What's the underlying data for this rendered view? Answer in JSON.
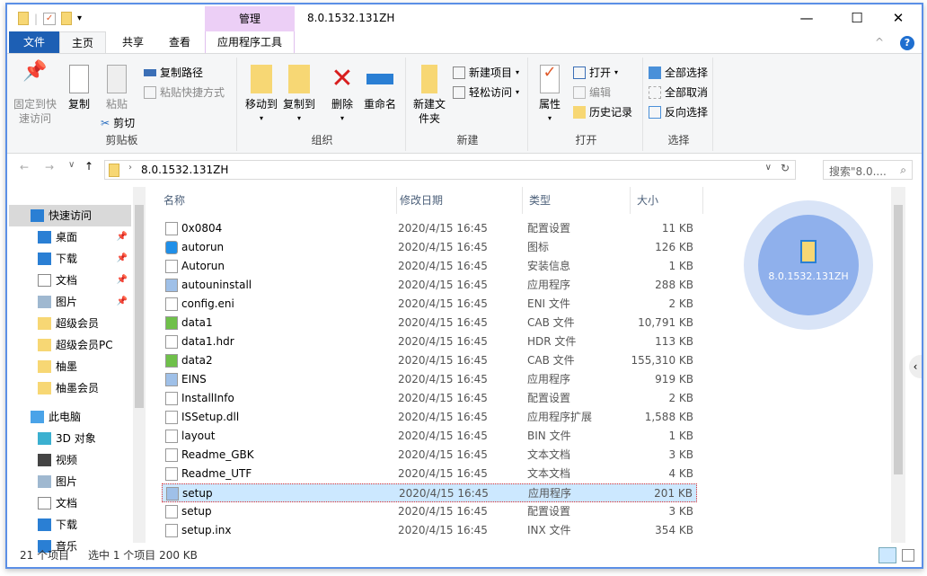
{
  "window": {
    "title": "8.0.1532.131ZH",
    "context_tab": "管理",
    "context_subtab": "应用程序工具",
    "border_color": "#5b8fe6"
  },
  "tabs": [
    {
      "label": "文件"
    },
    {
      "label": "主页"
    },
    {
      "label": "共享"
    },
    {
      "label": "查看"
    }
  ],
  "ribbon": {
    "clipboard": {
      "label": "剪贴板",
      "pin": "固定到快速访问",
      "copy": "复制",
      "paste": "粘贴",
      "copy_path": "复制路径",
      "paste_shortcut": "粘贴快捷方式",
      "cut": "剪切"
    },
    "organize": {
      "label": "组织",
      "move_to": "移动到",
      "copy_to": "复制到",
      "delete": "删除",
      "rename": "重命名"
    },
    "new": {
      "label": "新建",
      "new_folder": "新建文件夹",
      "new_item": "新建项目",
      "easy_access": "轻松访问"
    },
    "open": {
      "label": "打开",
      "properties": "属性",
      "open": "打开",
      "edit": "编辑",
      "history": "历史记录"
    },
    "select": {
      "label": "选择",
      "select_all": "全部选择",
      "select_none": "全部取消",
      "invert": "反向选择"
    }
  },
  "address": {
    "path": "8.0.1532.131ZH",
    "search_placeholder": "搜索\"8.0.... "
  },
  "sidebar": {
    "items": [
      {
        "label": "快速访问",
        "icon": "star-icon",
        "pinned": false
      },
      {
        "label": "桌面",
        "icon": "desktop-icon",
        "pinned": true
      },
      {
        "label": "下载",
        "icon": "download-icon",
        "pinned": true
      },
      {
        "label": "文档",
        "icon": "document-icon",
        "pinned": true
      },
      {
        "label": "图片",
        "icon": "picture-icon",
        "pinned": true
      },
      {
        "label": "超级会员",
        "icon": "folder-icon"
      },
      {
        "label": "超级会员PC",
        "icon": "folder-icon"
      },
      {
        "label": "柚墨",
        "icon": "folder-icon"
      },
      {
        "label": "柚墨会员",
        "icon": "folder-icon"
      },
      {
        "label": "此电脑",
        "icon": "computer-icon"
      },
      {
        "label": "3D 对象",
        "icon": "cube-icon"
      },
      {
        "label": "视频",
        "icon": "video-icon"
      },
      {
        "label": "图片",
        "icon": "picture-icon"
      },
      {
        "label": "文档",
        "icon": "document-icon"
      },
      {
        "label": "下载",
        "icon": "download-icon"
      },
      {
        "label": "音乐",
        "icon": "music-icon"
      }
    ]
  },
  "columns": {
    "name": "名称",
    "date": "修改日期",
    "type": "类型",
    "size": "大小"
  },
  "files": [
    {
      "name": "0x0804",
      "date": "2020/4/15 16:45",
      "type": "配置设置",
      "size": "11 KB"
    },
    {
      "name": "autorun",
      "date": "2020/4/15 16:45",
      "type": "图标",
      "size": "126 KB"
    },
    {
      "name": "Autorun",
      "date": "2020/4/15 16:45",
      "type": "安装信息",
      "size": "1 KB"
    },
    {
      "name": "autouninstall",
      "date": "2020/4/15 16:45",
      "type": "应用程序",
      "size": "288 KB"
    },
    {
      "name": "config.eni",
      "date": "2020/4/15 16:45",
      "type": "ENI 文件",
      "size": "2 KB"
    },
    {
      "name": "data1",
      "date": "2020/4/15 16:45",
      "type": "CAB 文件",
      "size": "10,791 KB"
    },
    {
      "name": "data1.hdr",
      "date": "2020/4/15 16:45",
      "type": "HDR 文件",
      "size": "113 KB"
    },
    {
      "name": "data2",
      "date": "2020/4/15 16:45",
      "type": "CAB 文件",
      "size": "155,310 KB"
    },
    {
      "name": "EINS",
      "date": "2020/4/15 16:45",
      "type": "应用程序",
      "size": "919 KB"
    },
    {
      "name": "InstallInfo",
      "date": "2020/4/15 16:45",
      "type": "配置设置",
      "size": "2 KB"
    },
    {
      "name": "ISSetup.dll",
      "date": "2020/4/15 16:45",
      "type": "应用程序扩展",
      "size": "1,588 KB"
    },
    {
      "name": "layout",
      "date": "2020/4/15 16:45",
      "type": "BIN 文件",
      "size": "1 KB"
    },
    {
      "name": "Readme_GBK",
      "date": "2020/4/15 16:45",
      "type": "文本文档",
      "size": "3 KB"
    },
    {
      "name": "Readme_UTF",
      "date": "2020/4/15 16:45",
      "type": "文本文档",
      "size": "4 KB"
    },
    {
      "name": "setup",
      "date": "2020/4/15 16:45",
      "type": "应用程序",
      "size": "201 KB",
      "selected": true
    },
    {
      "name": "setup",
      "date": "2020/4/15 16:45",
      "type": "配置设置",
      "size": "3 KB"
    },
    {
      "name": "setup.inx",
      "date": "2020/4/15 16:45",
      "type": "INX 文件",
      "size": "354 KB"
    }
  ],
  "preview": {
    "label": "8.0.1532.131ZH"
  },
  "status": {
    "count": "21 个项目",
    "selection": "选中 1 个项目  200 KB"
  }
}
